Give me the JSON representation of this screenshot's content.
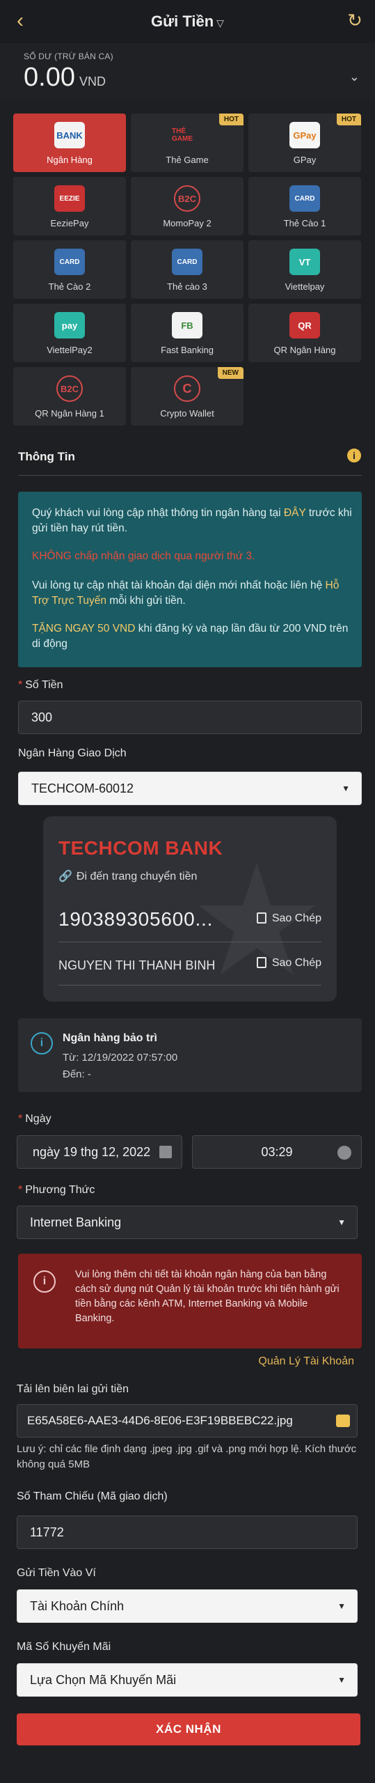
{
  "header": {
    "title": "Gửi Tiền",
    "title_chevron": "chevron-down-icon"
  },
  "balance": {
    "label": "SỐ DƯ (TRỪ BÁN CA)",
    "amount": "0.00",
    "unit": "VND"
  },
  "methods": [
    {
      "label": "Ngân Hàng",
      "icon": "BANK",
      "active": true,
      "badge": ""
    },
    {
      "label": "Thẻ Game",
      "icon": "THẺ GAME",
      "active": false,
      "badge": "HOT"
    },
    {
      "label": "GPay",
      "icon": "GPay",
      "active": false,
      "badge": "HOT"
    },
    {
      "label": "EeziePay",
      "icon": "EEZIE",
      "active": false,
      "badge": ""
    },
    {
      "label": "MomoPay 2",
      "icon": "B2C",
      "active": false,
      "badge": ""
    },
    {
      "label": "Thẻ Cào 1",
      "icon": "CARD",
      "active": false,
      "badge": ""
    },
    {
      "label": "Thẻ Cào 2",
      "icon": "CARD",
      "active": false,
      "badge": ""
    },
    {
      "label": "Thẻ cào 3",
      "icon": "CARD",
      "active": false,
      "badge": ""
    },
    {
      "label": "Viettelpay",
      "icon": "VT",
      "active": false,
      "badge": ""
    },
    {
      "label": "ViettelPay2",
      "icon": "pay",
      "active": false,
      "badge": ""
    },
    {
      "label": "Fast Banking",
      "icon": "FB",
      "active": false,
      "badge": ""
    },
    {
      "label": "QR Ngân Hàng",
      "icon": "QR",
      "active": false,
      "badge": ""
    },
    {
      "label": "QR Ngân Hàng 1",
      "icon": "B2C",
      "active": false,
      "badge": ""
    },
    {
      "label": "Crypto Wallet",
      "icon": "C",
      "active": false,
      "badge": "NEW"
    }
  ],
  "info": {
    "title": "Thông Tin",
    "line1_a": "Quý khách vui lòng cập nhật thông tin ngân hàng tại ",
    "line1_link": "ĐÂY",
    "line1_b": " trước khi gửi tiền hay rút tiền.",
    "warning": "KHÔNG chấp nhận giao dịch qua người thứ 3.",
    "line2_a": "Vui lòng tự cập nhật tài khoản đại diện mới nhất hoặc liên hệ ",
    "line2_link": "Hỗ Trợ Trực Tuyến",
    "line2_b": " mỗi khi gửi tiền.",
    "promo_link": "TẶNG NGAY 50 VND",
    "promo_rest": " khi đăng ký và nạp lần đầu từ 200 VND trên di động"
  },
  "amount": {
    "label": "Số Tiền",
    "value": "300"
  },
  "bank_select": {
    "label": "Ngân Hàng Giao Dịch",
    "value": "TECHCOM-60012"
  },
  "bank_card": {
    "bank_name": "TECHCOM BANK",
    "goto_link": "Đi đến trang chuyển tiền",
    "account_number": "190389305600...",
    "account_name": "NGUYEN THI THANH BINH",
    "copy_label": "Sao Chép"
  },
  "maintenance": {
    "title": "Ngân hàng bảo trì",
    "from": "Từ: 12/19/2022 07:57:00",
    "to": "Đến: -"
  },
  "date": {
    "label": "Ngày",
    "date_value": "ngày 19 thg 12, 2022",
    "time_value": "03:29"
  },
  "method": {
    "label": "Phương Thức",
    "value": "Internet Banking"
  },
  "warning_box": {
    "text": "Vui lòng thêm chi tiết tài khoản ngân hàng của bạn bằng cách sử dụng nút Quản lý tài khoản trước khi tiến hành gửi tiền bằng các kênh ATM, Internet Banking và Mobile Banking."
  },
  "manage_link": "Quản Lý Tài Khoản",
  "upload": {
    "label": "Tải lên biên lai gửi tiền",
    "value": "E65A58E6-AAE3-44D6-8E06-E3F19BBEBC22.jpg",
    "note": "Lưu ý: chỉ các file định dạng .jpeg .jpg .gif và .png mới hợp lệ. Kích thước không quá 5MB"
  },
  "reference": {
    "label": "Số Tham Chiếu (Mã giao dịch)",
    "value": "11772"
  },
  "wallet": {
    "label": "Gửi Tiền Vào Ví",
    "value": "Tài Khoản Chính"
  },
  "promo_code": {
    "label": "Mã Số Khuyến Mãi",
    "value": "Lựa Chọn Mã Khuyến Mãi"
  },
  "submit_label": "XÁC NHẬN",
  "colors": {
    "accent": "#c83a36",
    "gold": "#e3c27a",
    "notice_bg": "#1b5b63",
    "warning_bg": "#7c1e1e"
  }
}
